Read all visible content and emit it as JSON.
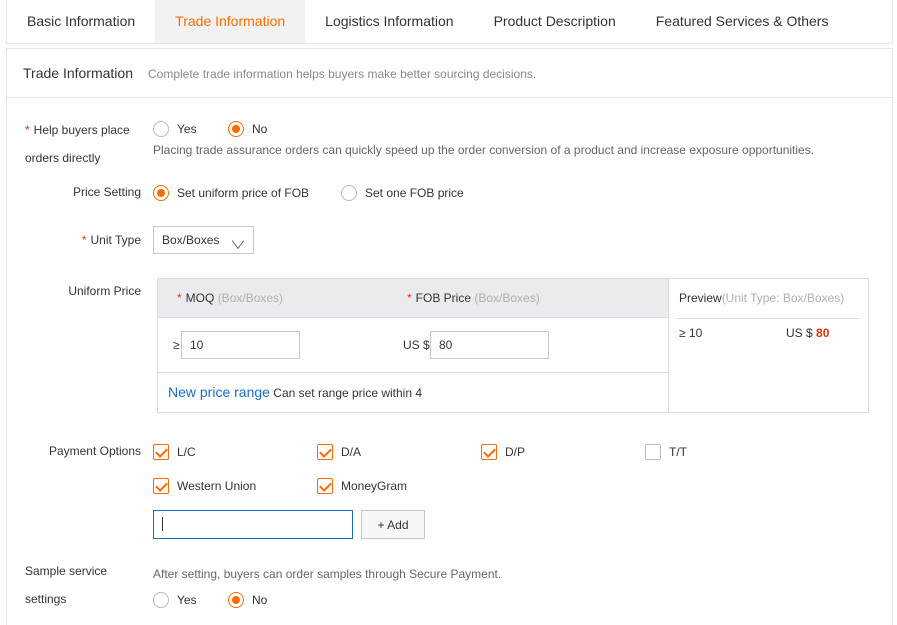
{
  "tabs": [
    {
      "label": "Basic Information",
      "active": false
    },
    {
      "label": "Trade Information",
      "active": true
    },
    {
      "label": "Logistics Information",
      "active": false
    },
    {
      "label": "Product Description",
      "active": false
    },
    {
      "label": "Featured Services & Others",
      "active": false
    }
  ],
  "header": {
    "title": "Trade Information",
    "subtitle": "Complete trade information helps buyers make better sourcing decisions."
  },
  "help_buyers": {
    "required_mark": "*",
    "label_line1": "Help buyers place",
    "label_line2": "orders directly",
    "yes": "Yes",
    "no": "No",
    "selected": "No",
    "hint": "Placing trade assurance orders can quickly speed up the order conversion of a product and increase exposure opportunities."
  },
  "price_setting": {
    "label": "Price Setting",
    "option1": "Set uniform price of FOB",
    "option2": "Set one FOB price",
    "selected": "Set uniform price of FOB"
  },
  "unit_type": {
    "required_mark": "*",
    "label": "Unit Type",
    "value": "Box/Boxes"
  },
  "uniform_price": {
    "label": "Uniform Price",
    "moq_header": "MOQ",
    "moq_unit": "(Box/Boxes)",
    "fob_header": "FOB Price",
    "fob_unit": "(Box/Boxes)",
    "required_mark": "*",
    "ge_symbol": "≥",
    "moq_value": "10",
    "currency": "US $",
    "fob_value": "80",
    "new_range_link": "New price range",
    "range_hint": "Can set range price within 4",
    "preview_title": "Preview",
    "preview_unit": "(Unit Type: Box/Boxes)",
    "preview_moq": "≥ 10",
    "preview_currency": "US $",
    "preview_price": "80"
  },
  "payment": {
    "label": "Payment Options",
    "options": [
      {
        "label": "L/C",
        "checked": true
      },
      {
        "label": "D/A",
        "checked": true
      },
      {
        "label": "D/P",
        "checked": true
      },
      {
        "label": "T/T",
        "checked": false
      },
      {
        "label": "Western Union",
        "checked": true
      },
      {
        "label": "MoneyGram",
        "checked": true
      }
    ],
    "custom_input_value": "",
    "add_button": "+ Add"
  },
  "sample": {
    "label_line1": "Sample service",
    "label_line2": "settings",
    "hint": "After setting, buyers can order samples through Secure Payment.",
    "yes": "Yes",
    "no": "No",
    "selected": "No"
  },
  "colors": {
    "accent": "#ff6a00",
    "link": "#1a6ec2",
    "required": "#e62e04",
    "price": "#e62e04"
  }
}
